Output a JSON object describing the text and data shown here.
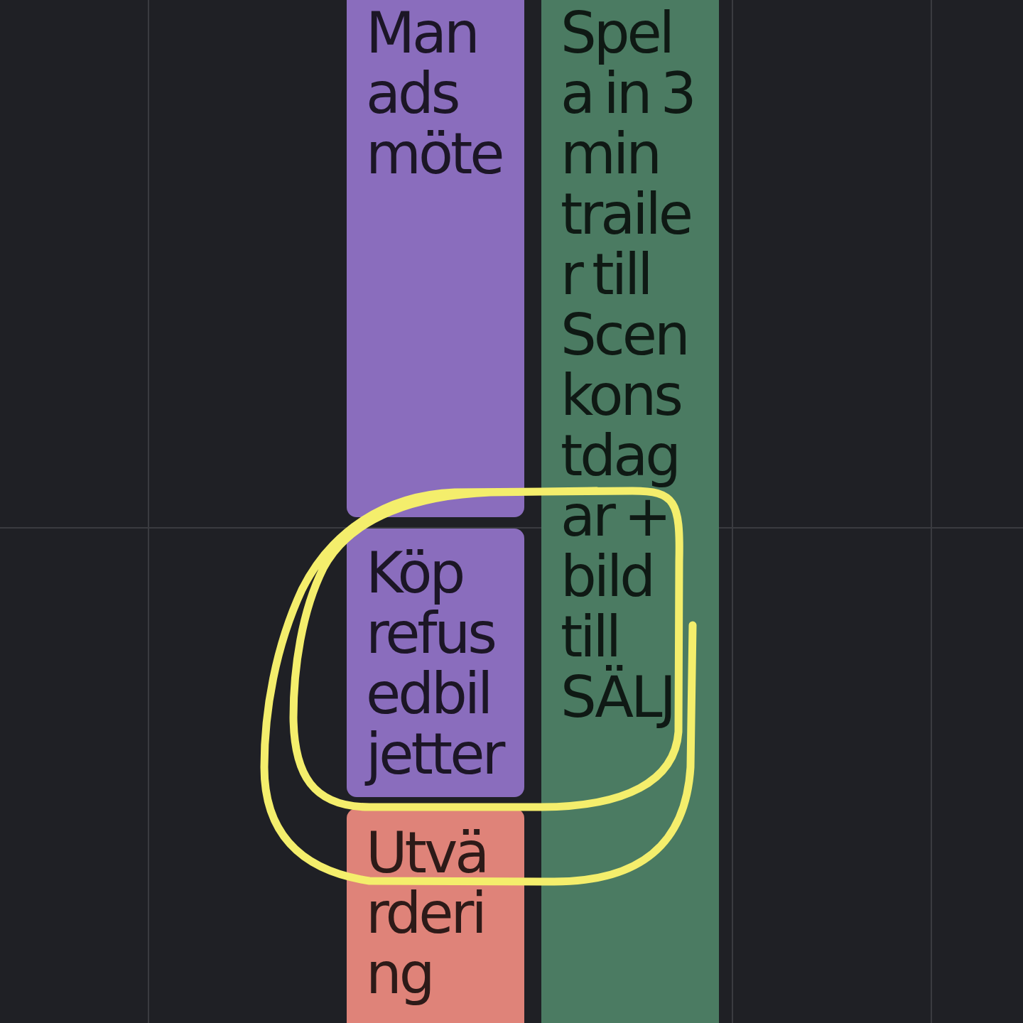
{
  "calendar": {
    "day_columns": [
      {
        "events": [
          {
            "title": "Manadsmöte",
            "color": "#8a6dbd"
          },
          {
            "title": "Köp refusedbiljetter",
            "color": "#8a6dbd"
          },
          {
            "title": "Utvärdering",
            "color": "#df8379"
          }
        ]
      },
      {
        "events": [
          {
            "title": "Spela in 3 min trailer till Scenkonstdagar + bild till SÄLJ",
            "color": "#4b7b62"
          }
        ]
      }
    ]
  }
}
